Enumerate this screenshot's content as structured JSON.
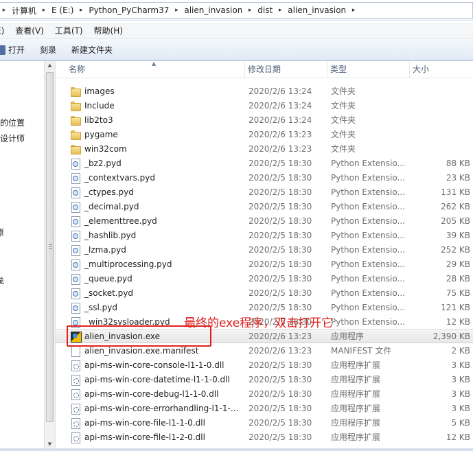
{
  "address_bar": {
    "crumbs": [
      "计算机",
      "E (E:)",
      "Python_PyCharm37",
      "alien_invasion",
      "dist",
      "alien_invasion"
    ]
  },
  "menu": {
    "items": [
      "E)",
      "查看(V)",
      "工具(T)",
      "帮助(H)"
    ]
  },
  "toolbar": {
    "open_label": "打开",
    "burn_label": "刻录",
    "new_folder_label": "新建文件夹"
  },
  "nav_pane": {
    "fragments": [
      "的位置",
      "设计师",
      "原",
      "戋"
    ]
  },
  "columns": {
    "name": "名称",
    "date": "修改日期",
    "type": "类型",
    "size": "大小"
  },
  "files": [
    {
      "name": "images",
      "date": "2020/2/6 13:24",
      "type": "文件夹",
      "size": "",
      "icon": "folder-icon"
    },
    {
      "name": "Include",
      "date": "2020/2/6 13:24",
      "type": "文件夹",
      "size": "",
      "icon": "folder-icon"
    },
    {
      "name": "lib2to3",
      "date": "2020/2/6 13:24",
      "type": "文件夹",
      "size": "",
      "icon": "folder-icon"
    },
    {
      "name": "pygame",
      "date": "2020/2/6 13:23",
      "type": "文件夹",
      "size": "",
      "icon": "folder-icon"
    },
    {
      "name": "win32com",
      "date": "2020/2/6 13:23",
      "type": "文件夹",
      "size": "",
      "icon": "folder-icon"
    },
    {
      "name": "_bz2.pyd",
      "date": "2020/2/5 18:30",
      "type": "Python Extensio...",
      "size": "88 KB",
      "icon": "pyd-file-icon"
    },
    {
      "name": "_contextvars.pyd",
      "date": "2020/2/5 18:30",
      "type": "Python Extensio...",
      "size": "23 KB",
      "icon": "pyd-file-icon"
    },
    {
      "name": "_ctypes.pyd",
      "date": "2020/2/5 18:30",
      "type": "Python Extensio...",
      "size": "131 KB",
      "icon": "pyd-file-icon"
    },
    {
      "name": "_decimal.pyd",
      "date": "2020/2/5 18:30",
      "type": "Python Extensio...",
      "size": "262 KB",
      "icon": "pyd-file-icon"
    },
    {
      "name": "_elementtree.pyd",
      "date": "2020/2/5 18:30",
      "type": "Python Extensio...",
      "size": "205 KB",
      "icon": "pyd-file-icon"
    },
    {
      "name": "_hashlib.pyd",
      "date": "2020/2/5 18:30",
      "type": "Python Extensio...",
      "size": "39 KB",
      "icon": "pyd-file-icon"
    },
    {
      "name": "_lzma.pyd",
      "date": "2020/2/5 18:30",
      "type": "Python Extensio...",
      "size": "252 KB",
      "icon": "pyd-file-icon"
    },
    {
      "name": "_multiprocessing.pyd",
      "date": "2020/2/5 18:30",
      "type": "Python Extensio...",
      "size": "29 KB",
      "icon": "pyd-file-icon"
    },
    {
      "name": "_queue.pyd",
      "date": "2020/2/5 18:30",
      "type": "Python Extensio...",
      "size": "28 KB",
      "icon": "pyd-file-icon"
    },
    {
      "name": "_socket.pyd",
      "date": "2020/2/5 18:30",
      "type": "Python Extensio...",
      "size": "75 KB",
      "icon": "pyd-file-icon"
    },
    {
      "name": "_ssl.pyd",
      "date": "2020/2/5 18:30",
      "type": "Python Extensio...",
      "size": "121 KB",
      "icon": "pyd-file-icon"
    },
    {
      "name": "_win32sysloader.pyd",
      "date": "2020/2/5 18:30",
      "type": "Python Extensio...",
      "size": "12 KB",
      "icon": "pyd-file-icon"
    },
    {
      "name": "alien_invasion.exe",
      "date": "2020/2/6 13:23",
      "type": "应用程序",
      "size": "2,390 KB",
      "icon": "exe-icon",
      "selected": true
    },
    {
      "name": "alien_invasion.exe.manifest",
      "date": "2020/2/6 13:23",
      "type": "MANIFEST 文件",
      "size": "2 KB",
      "icon": "manifest-icon"
    },
    {
      "name": "api-ms-win-core-console-l1-1-0.dll",
      "date": "2020/2/5 18:30",
      "type": "应用程序扩展",
      "size": "3 KB",
      "icon": "dll-icon"
    },
    {
      "name": "api-ms-win-core-datetime-l1-1-0.dll",
      "date": "2020/2/5 18:30",
      "type": "应用程序扩展",
      "size": "3 KB",
      "icon": "dll-icon"
    },
    {
      "name": "api-ms-win-core-debug-l1-1-0.dll",
      "date": "2020/2/5 18:30",
      "type": "应用程序扩展",
      "size": "3 KB",
      "icon": "dll-icon"
    },
    {
      "name": "api-ms-win-core-errorhandling-l1-1-...",
      "date": "2020/2/5 18:30",
      "type": "应用程序扩展",
      "size": "3 KB",
      "icon": "dll-icon"
    },
    {
      "name": "api-ms-win-core-file-l1-1-0.dll",
      "date": "2020/2/5 18:30",
      "type": "应用程序扩展",
      "size": "5 KB",
      "icon": "dll-icon"
    },
    {
      "name": "api-ms-win-core-file-l1-2-0.dll",
      "date": "2020/2/5 18:30",
      "type": "应用程序扩展",
      "size": "12 KB",
      "icon": "dll-icon"
    }
  ],
  "annotation": {
    "text": "最终的exe程序，双击打开它",
    "color": "#e0201d"
  }
}
